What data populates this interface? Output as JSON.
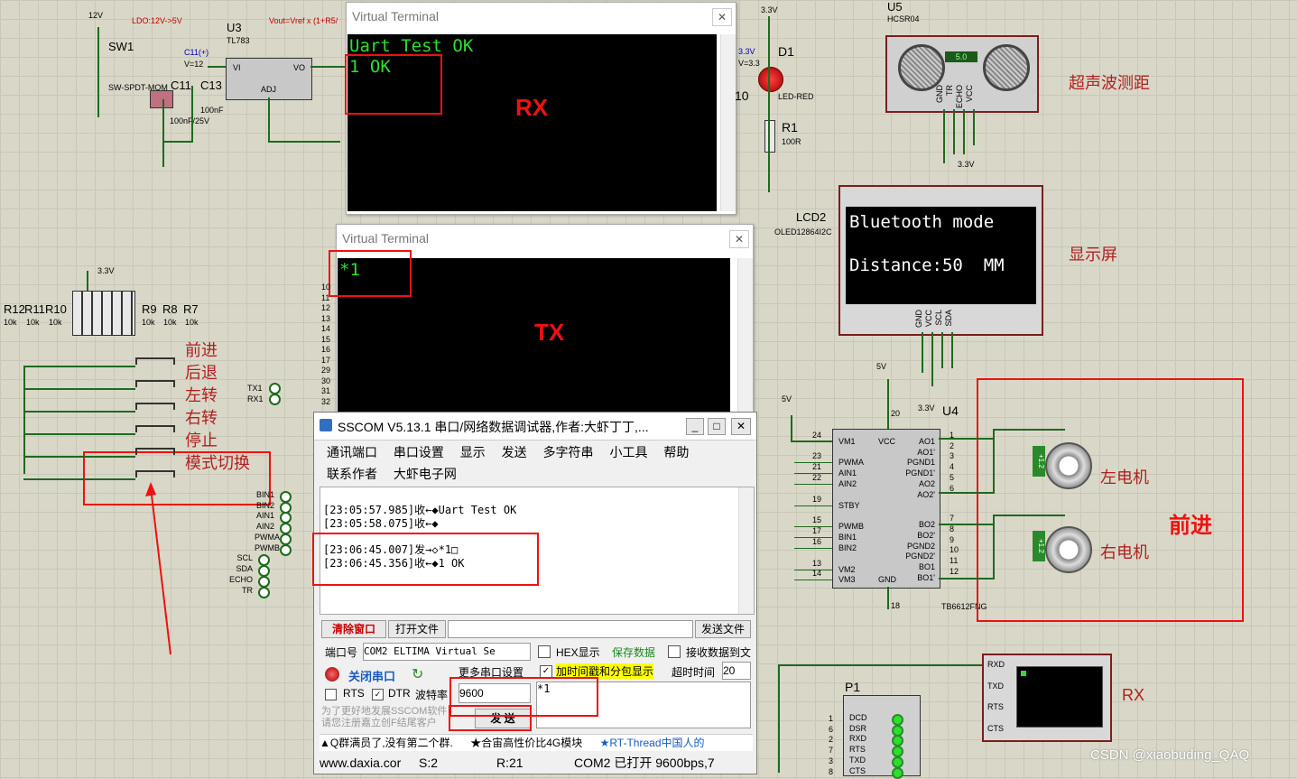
{
  "schematic": {
    "power_left": {
      "v12": "12V",
      "ldo_note": "LDO:12V->5V",
      "vout_note": "Vout=Vref x (1+R5/",
      "u3": "U3",
      "u3_part": "TL783",
      "u3_vi": "VI",
      "u3_vo": "VO",
      "u3_adj": "ADJ",
      "sw1": "SW1",
      "sw1_part": "SW-SPDT-MOM",
      "c11": "C11(+)",
      "v12pin": "V=12",
      "c11b": "C11",
      "c13": "C13",
      "c13_val": "100nF",
      "c11_val": "100nF/25V"
    },
    "d1": {
      "label": "D1",
      "part": "LED-RED",
      "v": "3.3V",
      "vpin": "V=3.3",
      "r1": "R1",
      "r1_val": "100R",
      "v33": "3.3V"
    },
    "u5": {
      "label": "U5",
      "part": "HCSR04",
      "display": "5.0",
      "pins": [
        "GND",
        "TR",
        "ECHO",
        "VCC"
      ],
      "cn": "超声波测距",
      "v": "3.3V"
    },
    "lcd2": {
      "label": "LCD2",
      "part": "OLED12864I2C",
      "line1": "Bluetooth mode",
      "line2": "Distance:50  MM",
      "pins": [
        "GND",
        "VCC",
        "SCL",
        "SDA"
      ],
      "cn": "显示屏",
      "v5": "5V",
      "v33": "3.3V"
    },
    "resistors": {
      "v": "3.3V",
      "left": [
        "R12",
        "R11",
        "R10"
      ],
      "right": [
        "R9",
        "R8",
        "R7"
      ],
      "val": "10k"
    },
    "buttons": [
      "前进",
      "后退",
      "左转",
      "右转",
      "停止",
      "模式切换"
    ],
    "serial_pins": [
      "TX1",
      "RX1"
    ],
    "mcu_pins": [
      "BIN1",
      "BIN2",
      "AIN1",
      "AIN2",
      "PWMA",
      "PWMB",
      "SCL",
      "SDA",
      "ECHO",
      "TR"
    ],
    "pin_numbers": [
      "10",
      "11",
      "12",
      "13",
      "14",
      "15",
      "16",
      "17",
      "29",
      "30",
      "31",
      "32"
    ],
    "u4": {
      "label": "U4",
      "part": "TB6612FNG",
      "v5": "5V",
      "left_pins": [
        "VM1",
        "PWMA",
        "AIN1",
        "AIN2",
        "STBY",
        "PWMB",
        "BIN1",
        "BIN2",
        "VM2",
        "VM3"
      ],
      "top_pins": [
        "VCC"
      ],
      "bottom_pins": [
        "GND"
      ],
      "right_pins": [
        "AO1",
        "AO1'",
        "PGND1",
        "PGND1'",
        "AO2",
        "AO2'",
        "BO2",
        "BO2'",
        "PGND2",
        "PGND2'",
        "BO1",
        "BO1'"
      ],
      "left_nums": [
        "24",
        "23",
        "21",
        "22",
        "19",
        "15",
        "17",
        "16",
        "13",
        "14"
      ],
      "right_nums": [
        "1",
        "2",
        "3",
        "4",
        "5",
        "6",
        "7",
        "8",
        "9",
        "10",
        "11",
        "12"
      ],
      "top_num": "20",
      "bottom_num": "18"
    },
    "motors": {
      "left": "左电机",
      "right": "右电机",
      "status": "前进",
      "lm": "+1.2",
      "rm": "+1.2"
    },
    "p1": {
      "label": "P1",
      "pins": [
        "DCD",
        "DSR",
        "RXD",
        "RTS",
        "TXD",
        "CTS"
      ],
      "nums": [
        "1",
        "6",
        "2",
        "7",
        "3",
        "8"
      ]
    },
    "vt3": {
      "pins": [
        "RXD",
        "TXD",
        "RTS",
        "CTS"
      ],
      "cn": "RX"
    }
  },
  "vt_rx": {
    "title": "Virtual Terminal",
    "line1": "Uart Test OK",
    "line2": "1 OK",
    "tag": "RX",
    "close": "✕"
  },
  "vt_tx": {
    "title": "Virtual Terminal",
    "line1": "*1",
    "tag": "TX",
    "close": "✕"
  },
  "sscom": {
    "title": "SSCOM V5.13.1 串口/网络数据调试器,作者:大虾丁丁,...",
    "menu1": [
      "通讯端口",
      "串口设置",
      "显示",
      "发送",
      "多字符串",
      "小工具",
      "帮助"
    ],
    "menu2": [
      "联系作者",
      "大虾电子网"
    ],
    "log": [
      "[23:05:57.985]收←◆Uart Test OK",
      "[23:05:58.075]收←◆",
      "[23:06:45.007]发→◇*1□",
      "[23:06:45.356]收←◆1 OK"
    ],
    "clear_btn": "清除窗口",
    "open_file": "打开文件",
    "send_file": "发送文件",
    "port_label": "端口号",
    "port_value": "COM2 ELTIMA Virtual Se",
    "hex_show": "HEX显示",
    "save_data": "保存数据",
    "recv_to_file": "接收数据到文",
    "close_port": "关闭串口",
    "more_settings": "更多串口设置",
    "timestamp": "加时间戳和分包显示",
    "timeout": "超时时间",
    "timeout_val": "20",
    "rts": "RTS",
    "dtr": "DTR",
    "baud_label": "波特率",
    "baud_value": "9600",
    "send_input": "*1",
    "send_btn": "发 送",
    "promo": "为了更好地发展SSCOM软件\n请您注册嘉立创F结尾客户",
    "ticker1": "▲Q群满员了,没有第二个群.",
    "ticker2": "★合宙高性价比4G模块",
    "ticker3": "★RT-Thread中国人的",
    "status_url": "www.daxia.cor",
    "status_s": "S:2",
    "status_r": "R:21",
    "status_port": "COM2 已打开  9600bps,7"
  },
  "watermark": "CSDN @xiaobuding_QAQ"
}
